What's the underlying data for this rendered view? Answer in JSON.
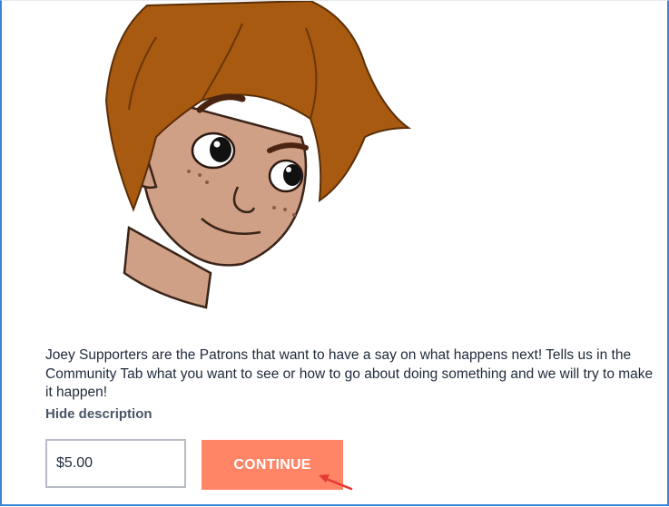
{
  "tier": {
    "description": "Joey Supporters are the Patrons that want to have a say on what happens next! Tells us in the Community Tab what you want to see or how to go about doing something and we will try to make it happen!",
    "toggle_label": "Hide description",
    "amount_value": "$5.00",
    "continue_label": "CONTINUE"
  },
  "image": {
    "subject": "cartoon-boy-with-orange-hair"
  },
  "colors": {
    "border": "#3b82d6",
    "button": "#ff8566",
    "hair": "#a85a10",
    "skin": "#cf9f86",
    "annotation": "#e53935"
  }
}
